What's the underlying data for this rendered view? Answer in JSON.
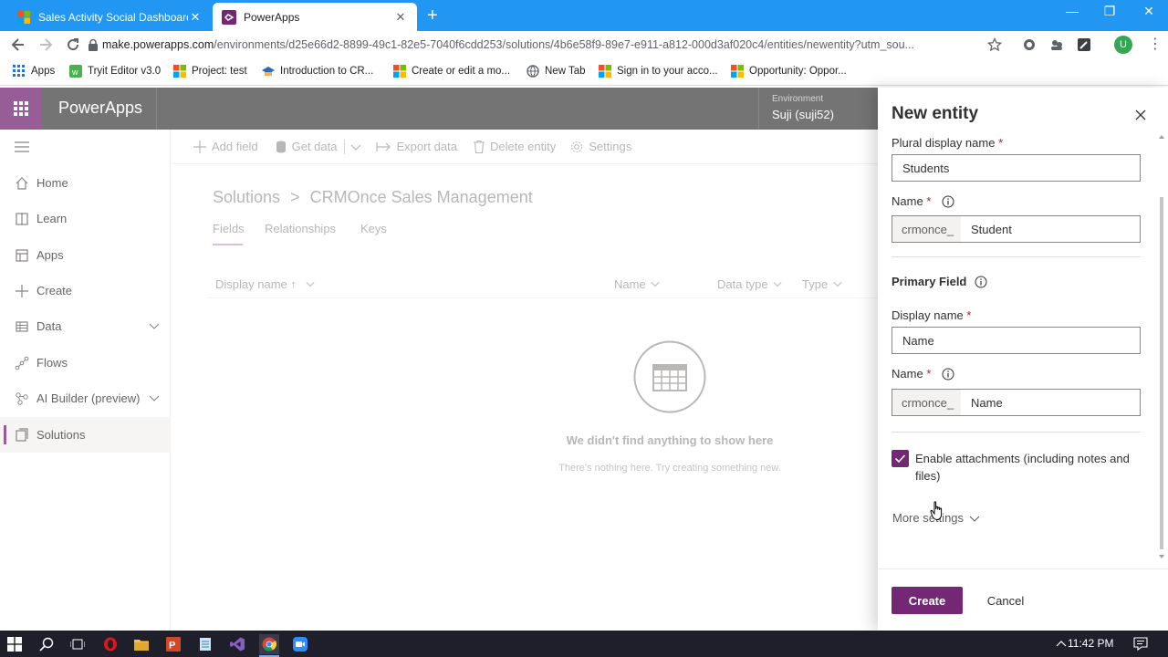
{
  "browser": {
    "tabs": [
      {
        "title": "Sales Activity Social Dashboard",
        "close": "✕"
      },
      {
        "title": "PowerApps",
        "close": "✕"
      }
    ],
    "new_tab": "+",
    "window_controls": {
      "minimize": "—",
      "restore": "❐",
      "close": "✕"
    },
    "url_host": "make.powerapps.com",
    "url_path": "/environments/d25e66d2-8899-49c1-82e5-7040f6cdd253/solutions/4b6e58f9-89e7-e911-a812-000d3af020c4/entities/newentity?utm_sou...",
    "profile_initial": "U",
    "bookmarks": [
      {
        "label": "Apps",
        "icon": "apps-grid-icon"
      },
      {
        "label": "Tryit Editor v3.0",
        "icon": "w3schools-icon"
      },
      {
        "label": "Project: test",
        "icon": "microsoft-icon"
      },
      {
        "label": "Introduction to CR...",
        "icon": "graduation-icon"
      },
      {
        "label": "Create or edit a mo...",
        "icon": "microsoft-icon"
      },
      {
        "label": "New Tab",
        "icon": "globe-icon"
      },
      {
        "label": "Sign in to your acco...",
        "icon": "microsoft-icon"
      },
      {
        "label": "Opportunity: Oppor...",
        "icon": "microsoft-icon"
      }
    ]
  },
  "app": {
    "brand": "PowerApps",
    "environment_label": "Environment",
    "environment_name": "Suji (suji52)",
    "nav": [
      {
        "label": "Home",
        "icon": "home-icon"
      },
      {
        "label": "Learn",
        "icon": "book-icon"
      },
      {
        "label": "Apps",
        "icon": "apps-icon"
      },
      {
        "label": "Create",
        "icon": "plus-icon"
      },
      {
        "label": "Data",
        "icon": "table-icon"
      },
      {
        "label": "Flows",
        "icon": "flow-icon"
      },
      {
        "label": "AI Builder (preview)",
        "icon": "ai-builder-icon"
      },
      {
        "label": "Solutions",
        "icon": "solutions-icon"
      }
    ],
    "commands": {
      "add_field": "Add field",
      "get_data": "Get data",
      "export_data": "Export data",
      "delete_entity": "Delete entity",
      "settings": "Settings"
    },
    "breadcrumb": {
      "root": "Solutions",
      "separator": ">",
      "current": "CRMOnce Sales Management"
    },
    "pivots": {
      "fields": "Fields",
      "relationships": "Relationships",
      "keys": "Keys"
    },
    "columns": {
      "display_name": "Display name ↑",
      "name": "Name",
      "data_type": "Data type",
      "type": "Type"
    },
    "empty": {
      "title": "We didn't find anything to show here",
      "subtitle": "There's nothing here. Try creating something new."
    }
  },
  "panel": {
    "title": "New entity",
    "plural_label": "Plural display name",
    "plural_value": "Students",
    "name_label": "Name",
    "prefix": "crmonce_",
    "name_value": "Student",
    "primary_field_heading": "Primary Field",
    "display_name_label": "Display name",
    "display_name_value": "Name",
    "primary_name_label": "Name",
    "primary_name_value": "Name",
    "required_marker": "*",
    "attachments_label": "Enable attachments (including notes and files)",
    "attachments_checked": true,
    "more_settings": "More settings",
    "create_button": "Create",
    "cancel_button": "Cancel"
  },
  "taskbar": {
    "clock": "11:42 PM"
  },
  "colors": {
    "accent": "#742774",
    "browser_blue": "#2196f3",
    "app_header": "#464646",
    "taskbar": "#1f1f2b"
  }
}
